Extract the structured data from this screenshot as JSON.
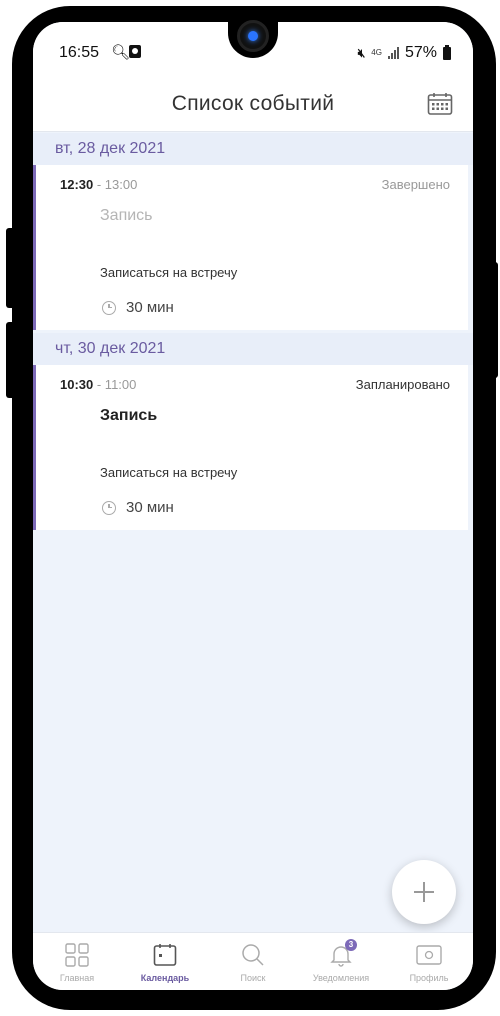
{
  "status_bar": {
    "time": "16:55",
    "network": "4G",
    "battery": "57%"
  },
  "header": {
    "title": "Список событий",
    "calendar_icon": "calendar-grid-icon"
  },
  "groups": [
    {
      "date": "вт, 28 дек 2021",
      "events": [
        {
          "start": "12:30",
          "end": " - 13:00",
          "status": "Завершено",
          "title": "Запись",
          "description": "Записаться на встречу",
          "duration": "30 мин"
        }
      ]
    },
    {
      "date": "чт, 30 дек 2021",
      "events": [
        {
          "start": "10:30",
          "end": " - 11:00",
          "status": "Запланировано",
          "title": "Запись",
          "description": "Записаться на встречу",
          "duration": "30 мин"
        }
      ]
    }
  ],
  "tabbar": {
    "items": [
      {
        "label": "Главная",
        "icon": "grid-icon"
      },
      {
        "label": "Календарь",
        "icon": "calendar-icon"
      },
      {
        "label": "Поиск",
        "icon": "search-icon"
      },
      {
        "label": "Уведомления",
        "icon": "bell-icon",
        "badge": "3"
      },
      {
        "label": "Профиль",
        "icon": "profile-card-icon"
      }
    ],
    "active": "Календарь"
  },
  "colors": {
    "accent": "#7d6ab8",
    "background": "#eef3fb"
  }
}
